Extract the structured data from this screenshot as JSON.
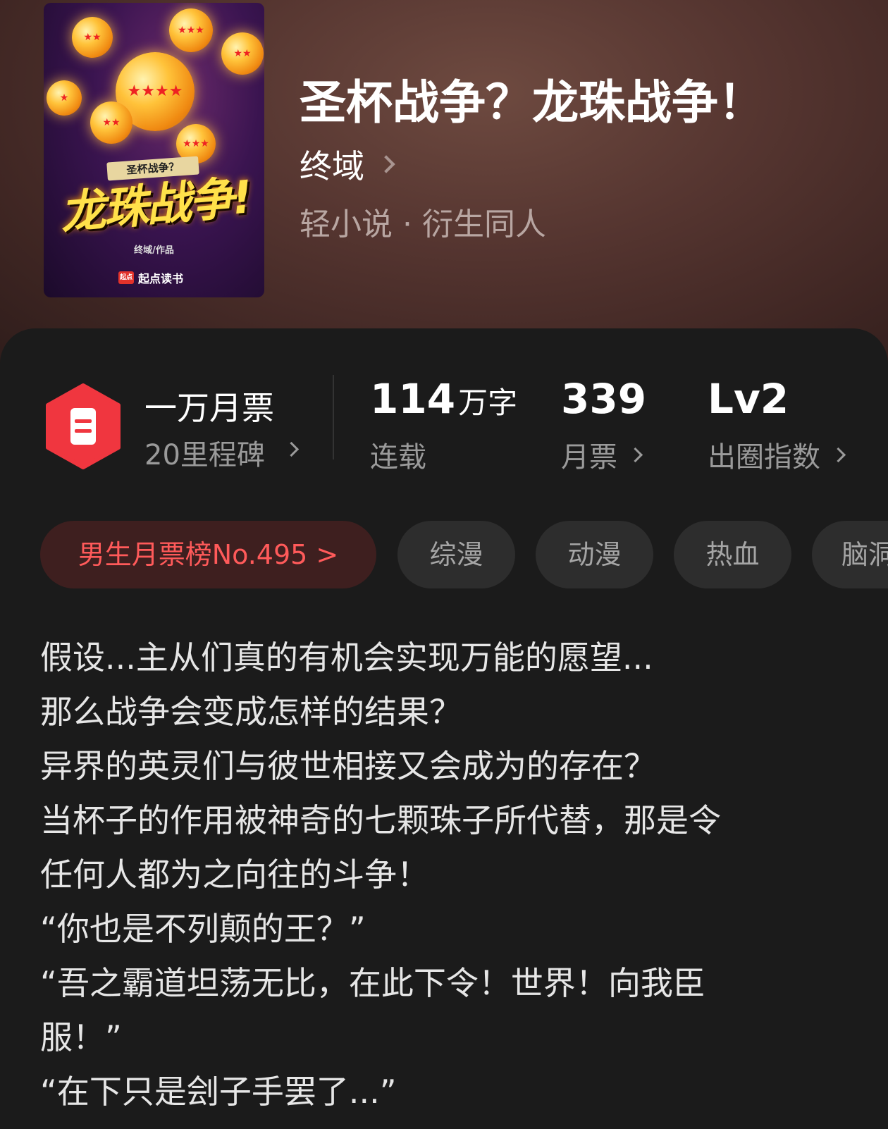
{
  "book": {
    "title": "圣杯战争？龙珠战争！",
    "author": "终域",
    "genre": "轻小说 · 衍生同人"
  },
  "cover": {
    "subtitle": "圣杯战争？",
    "title": "龙珠战争!",
    "author_line": "终域/作品",
    "brand_logo": "起点",
    "brand": "起点读书"
  },
  "milestone": {
    "title": "一万月票",
    "subtitle": "20里程碑",
    "icon": "ticket-hexagon-icon",
    "color": "#f0363f"
  },
  "stats": [
    {
      "value": "114",
      "unit": "万字",
      "label": "连载"
    },
    {
      "value": "339",
      "label": "月票"
    },
    {
      "value": "Lv2",
      "label": "出圈指数"
    }
  ],
  "tags": [
    {
      "label": "男生月票榜No.495 >"
    },
    {
      "label": "综漫"
    },
    {
      "label": "动漫"
    },
    {
      "label": "热血"
    },
    {
      "label": "脑洞"
    }
  ],
  "description": [
    "假设...主从们真的有机会实现万能的愿望...",
    "那么战争会变成怎样的结果？",
    "异界的英灵们与彼世相接又会成为的存在？",
    "当杯子的作用被神奇的七颗珠子所代替，那是令",
    "任何人都为之向往的斗争！",
    "“你也是不列颠的王？”",
    "“吾之霸道坦荡无比，在此下令！世界！向我臣",
    "服！”",
    "“在下只是刽子手罢了...”"
  ]
}
